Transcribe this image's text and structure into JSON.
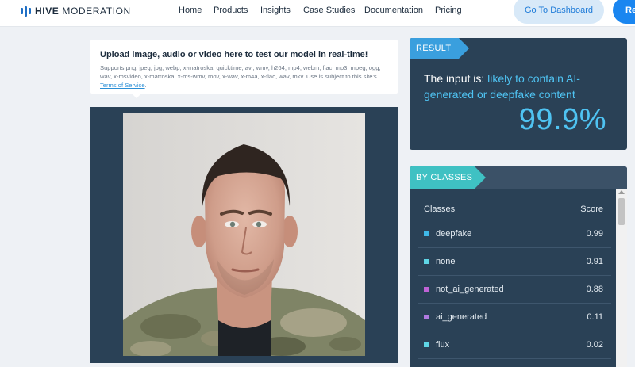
{
  "nav": {
    "logo_bold": "HIVE",
    "logo_light": "MODERATION",
    "links": [
      "Home",
      "Products",
      "Insights",
      "Case Studies",
      "Documentation",
      "Pricing"
    ],
    "dashboard_button": "Go To Dashboard",
    "request_button": "Re"
  },
  "upload": {
    "title": "Upload image, audio or video here to test our model in real-time!",
    "description": "Supports png, jpeg, jpg, webp, x-matroska, quicktime, avi, wmv, h264, mp4, webm, flac, mp3, mpeg, ogg, wav, x-msvideo, x-matroska, x-ms-wmv, mov, x-wav, x-m4a, x-flac, wav, mkv. Use is subject to this site's",
    "terms_link": "Terms of Service",
    "terms_suffix": "."
  },
  "result": {
    "tag": "RESULT",
    "prefix": "The input is: ",
    "verdict": "likely to contain AI-generated or deepfake content",
    "score": "99.9%"
  },
  "classes": {
    "tag": "BY CLASSES",
    "header_class": "Classes",
    "header_score": "Score",
    "rows": [
      {
        "name": "deepfake",
        "score": "0.99",
        "color": "#3fb8e8"
      },
      {
        "name": "none",
        "score": "0.91",
        "color": "#5fd6e6"
      },
      {
        "name": "not_ai_generated",
        "score": "0.88",
        "color": "#c063d6"
      },
      {
        "name": "ai_generated",
        "score": "0.11",
        "color": "#b07ae0"
      },
      {
        "name": "flux",
        "score": "0.02",
        "color": "#5fd6e6"
      }
    ]
  },
  "colors": {
    "brand_blue": "#1f6fc5",
    "panel_navy": "#2a4156",
    "result_accent": "#3a9fde",
    "classes_accent": "#3fc1c3",
    "score_cyan": "#4fc3f2"
  },
  "icons": [
    "hive-logo-icon",
    "scroll-up-icon"
  ]
}
